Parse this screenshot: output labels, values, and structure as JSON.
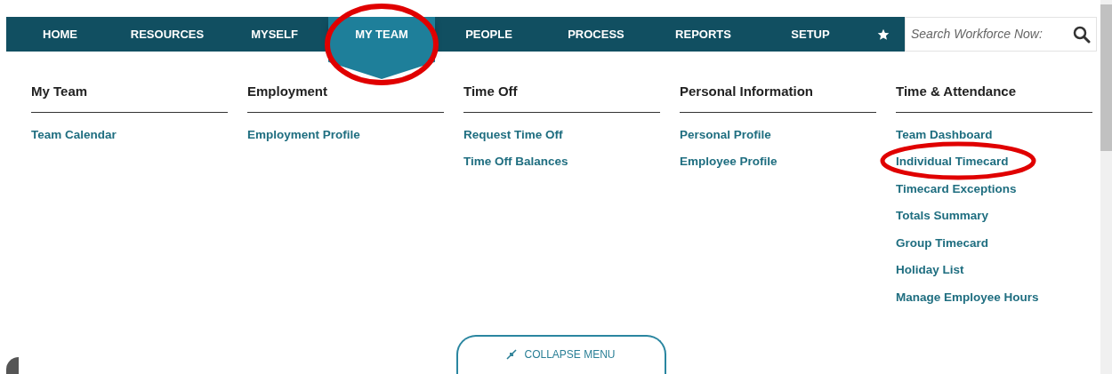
{
  "nav": {
    "tabs": [
      {
        "label": "HOME",
        "selected": false
      },
      {
        "label": "RESOURCES",
        "selected": false
      },
      {
        "label": "MYSELF",
        "selected": false
      },
      {
        "label": "MY TEAM",
        "selected": true
      },
      {
        "label": "PEOPLE",
        "selected": false
      },
      {
        "label": "PROCESS",
        "selected": false
      },
      {
        "label": "REPORTS",
        "selected": false
      },
      {
        "label": "SETUP",
        "selected": false
      }
    ],
    "search": {
      "placeholder": "Search Workforce Now:"
    }
  },
  "menu": {
    "columns": [
      {
        "heading": "My Team",
        "links": [
          {
            "label": "Team Calendar",
            "circled": false
          }
        ]
      },
      {
        "heading": "Employment",
        "links": [
          {
            "label": "Employment Profile",
            "circled": false
          }
        ]
      },
      {
        "heading": "Time Off",
        "links": [
          {
            "label": "Request Time Off",
            "circled": false
          },
          {
            "label": "Time Off Balances",
            "circled": false
          }
        ]
      },
      {
        "heading": "Personal Information",
        "links": [
          {
            "label": "Personal Profile",
            "circled": false
          },
          {
            "label": "Employee Profile",
            "circled": false
          }
        ]
      },
      {
        "heading": "Time & Attendance",
        "links": [
          {
            "label": "Team Dashboard",
            "circled": false
          },
          {
            "label": "Individual Timecard",
            "circled": true
          },
          {
            "label": "Timecard Exceptions",
            "circled": false
          },
          {
            "label": "Totals Summary",
            "circled": false
          },
          {
            "label": "Group Timecard",
            "circled": false
          },
          {
            "label": "Holiday List",
            "circled": false
          },
          {
            "label": "Manage Employee Hours",
            "circled": false
          }
        ]
      }
    ],
    "collapse_button": "COLLAPSE MENU"
  }
}
